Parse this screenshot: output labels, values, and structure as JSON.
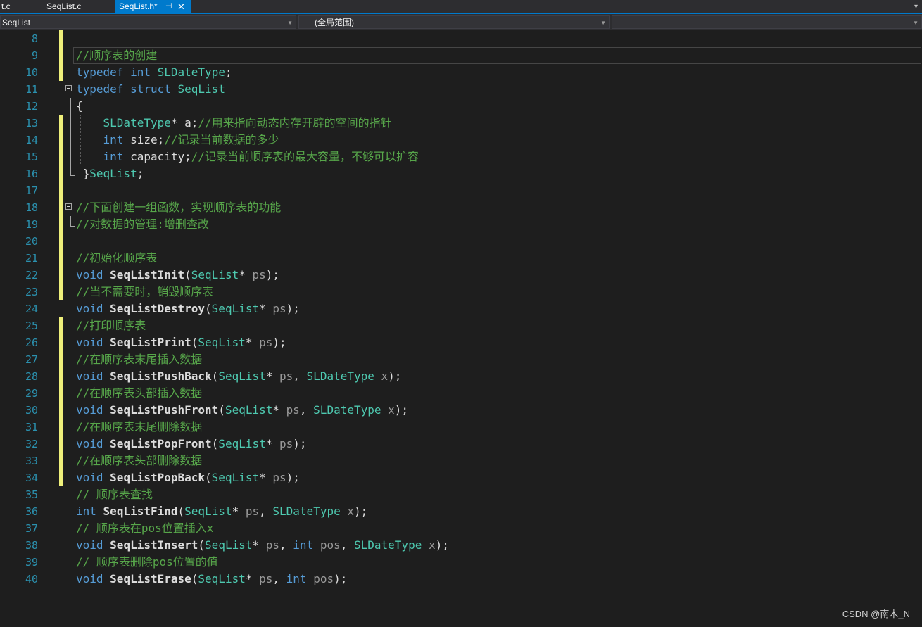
{
  "tabs": [
    {
      "label": "t.c"
    },
    {
      "label": "SeqList.c"
    },
    {
      "label": "SeqList.h*",
      "pin": "⊣",
      "close": "✕"
    }
  ],
  "nav": {
    "scope": "SeqList",
    "context": "(全局范围)",
    "member": ""
  },
  "watermark": "CSDN @南木_N",
  "colors": {
    "background": "#1e1e1e",
    "keyword": "#569cd6",
    "type": "#4ec9b0",
    "comment": "#57a64a",
    "line_number": "#2b91af",
    "change_marker": "#eff07b",
    "active_tab": "#007acc"
  },
  "lines": [
    {
      "n": "8",
      "chg": true,
      "seg": []
    },
    {
      "n": "9",
      "chg": true,
      "cur": true,
      "seg": [
        {
          "c": "cm",
          "t": "//顺序表的创建"
        }
      ]
    },
    {
      "n": "10",
      "chg": true,
      "seg": [
        {
          "c": "kw",
          "t": "typedef"
        },
        {
          "t": " "
        },
        {
          "c": "kw",
          "t": "int"
        },
        {
          "t": " "
        },
        {
          "c": "ty",
          "t": "SLDateType"
        },
        {
          "t": ";"
        }
      ]
    },
    {
      "n": "11",
      "fold": "open",
      "seg": [
        {
          "c": "kw",
          "t": "typedef"
        },
        {
          "t": " "
        },
        {
          "c": "kw",
          "t": "struct"
        },
        {
          "t": " "
        },
        {
          "c": "ty",
          "t": "SeqList"
        }
      ]
    },
    {
      "n": "12",
      "fold": "line",
      "seg": [
        {
          "t": "{"
        }
      ]
    },
    {
      "n": "13",
      "chg": true,
      "fold": "line",
      "guide": true,
      "seg": [
        {
          "t": "    "
        },
        {
          "c": "ty",
          "t": "SLDateType"
        },
        {
          "t": "* a;"
        },
        {
          "c": "cm",
          "t": "//用来指向动态内存开辟的空间的指针"
        }
      ]
    },
    {
      "n": "14",
      "chg": true,
      "fold": "line",
      "guide": true,
      "seg": [
        {
          "t": "    "
        },
        {
          "c": "kw",
          "t": "int"
        },
        {
          "t": " size;"
        },
        {
          "c": "cm",
          "t": "//记录当前数据的多少"
        }
      ]
    },
    {
      "n": "15",
      "chg": true,
      "fold": "line",
      "guide": true,
      "seg": [
        {
          "t": "    "
        },
        {
          "c": "kw",
          "t": "int"
        },
        {
          "t": " capacity;"
        },
        {
          "c": "cm",
          "t": "//记录当前顺序表的最大容量，不够可以扩容"
        }
      ]
    },
    {
      "n": "16",
      "chg": true,
      "fold": "end",
      "seg": [
        {
          "t": " }"
        },
        {
          "c": "ty",
          "t": "SeqList"
        },
        {
          "t": ";"
        }
      ]
    },
    {
      "n": "17",
      "chg": true,
      "seg": []
    },
    {
      "n": "18",
      "chg": true,
      "fold": "open",
      "seg": [
        {
          "c": "cm",
          "t": "//下面创建一组函数，实现顺序表的功能"
        }
      ]
    },
    {
      "n": "19",
      "chg": true,
      "fold": "end",
      "seg": [
        {
          "c": "cm",
          "t": "//对数据的管理:增删查改"
        }
      ]
    },
    {
      "n": "20",
      "chg": true,
      "seg": []
    },
    {
      "n": "21",
      "chg": true,
      "seg": [
        {
          "c": "cm",
          "t": "//初始化顺序表"
        }
      ]
    },
    {
      "n": "22",
      "chg": true,
      "seg": [
        {
          "c": "kw",
          "t": "void"
        },
        {
          "t": " "
        },
        {
          "c": "fn",
          "t": "SeqListInit"
        },
        {
          "t": "("
        },
        {
          "c": "ty",
          "t": "SeqList"
        },
        {
          "t": "* "
        },
        {
          "c": "pm",
          "t": "ps"
        },
        {
          "t": ");"
        }
      ]
    },
    {
      "n": "23",
      "chg": true,
      "seg": [
        {
          "c": "cm",
          "t": "//当不需要时，销毁顺序表"
        }
      ]
    },
    {
      "n": "24",
      "seg": [
        {
          "c": "kw",
          "t": "void"
        },
        {
          "t": " "
        },
        {
          "c": "fn",
          "t": "SeqListDestroy"
        },
        {
          "t": "("
        },
        {
          "c": "ty",
          "t": "SeqList"
        },
        {
          "t": "* "
        },
        {
          "c": "pm",
          "t": "ps"
        },
        {
          "t": ");"
        }
      ]
    },
    {
      "n": "25",
      "chg": true,
      "seg": [
        {
          "c": "cm",
          "t": "//打印顺序表"
        }
      ]
    },
    {
      "n": "26",
      "chg": true,
      "seg": [
        {
          "c": "kw",
          "t": "void"
        },
        {
          "t": " "
        },
        {
          "c": "fn",
          "t": "SeqListPrint"
        },
        {
          "t": "("
        },
        {
          "c": "ty",
          "t": "SeqList"
        },
        {
          "t": "* "
        },
        {
          "c": "pm",
          "t": "ps"
        },
        {
          "t": ");"
        }
      ]
    },
    {
      "n": "27",
      "chg": true,
      "seg": [
        {
          "c": "cm",
          "t": "//在顺序表末尾插入数据"
        }
      ]
    },
    {
      "n": "28",
      "chg": true,
      "seg": [
        {
          "c": "kw",
          "t": "void"
        },
        {
          "t": " "
        },
        {
          "c": "fn",
          "t": "SeqListPushBack"
        },
        {
          "t": "("
        },
        {
          "c": "ty",
          "t": "SeqList"
        },
        {
          "t": "* "
        },
        {
          "c": "pm",
          "t": "ps"
        },
        {
          "t": ", "
        },
        {
          "c": "ty",
          "t": "SLDateType"
        },
        {
          "t": " "
        },
        {
          "c": "pm",
          "t": "x"
        },
        {
          "t": ");"
        }
      ]
    },
    {
      "n": "29",
      "chg": true,
      "seg": [
        {
          "c": "cm",
          "t": "//在顺序表头部插入数据"
        }
      ]
    },
    {
      "n": "30",
      "chg": true,
      "seg": [
        {
          "c": "kw",
          "t": "void"
        },
        {
          "t": " "
        },
        {
          "c": "fn",
          "t": "SeqListPushFront"
        },
        {
          "t": "("
        },
        {
          "c": "ty",
          "t": "SeqList"
        },
        {
          "t": "* "
        },
        {
          "c": "pm",
          "t": "ps"
        },
        {
          "t": ", "
        },
        {
          "c": "ty",
          "t": "SLDateType"
        },
        {
          "t": " "
        },
        {
          "c": "pm",
          "t": "x"
        },
        {
          "t": ");"
        }
      ]
    },
    {
      "n": "31",
      "chg": true,
      "seg": [
        {
          "c": "cm",
          "t": "//在顺序表末尾删除数据"
        }
      ]
    },
    {
      "n": "32",
      "chg": true,
      "seg": [
        {
          "c": "kw",
          "t": "void"
        },
        {
          "t": " "
        },
        {
          "c": "fn",
          "t": "SeqListPopFront"
        },
        {
          "t": "("
        },
        {
          "c": "ty",
          "t": "SeqList"
        },
        {
          "t": "* "
        },
        {
          "c": "pm",
          "t": "ps"
        },
        {
          "t": ");"
        }
      ]
    },
    {
      "n": "33",
      "chg": true,
      "seg": [
        {
          "c": "cm",
          "t": "//在顺序表头部删除数据"
        }
      ]
    },
    {
      "n": "34",
      "chg": true,
      "seg": [
        {
          "c": "kw",
          "t": "void"
        },
        {
          "t": " "
        },
        {
          "c": "fn",
          "t": "SeqListPopBack"
        },
        {
          "t": "("
        },
        {
          "c": "ty",
          "t": "SeqList"
        },
        {
          "t": "* "
        },
        {
          "c": "pm",
          "t": "ps"
        },
        {
          "t": ");"
        }
      ]
    },
    {
      "n": "35",
      "seg": [
        {
          "c": "cm",
          "t": "// 顺序表查找"
        }
      ]
    },
    {
      "n": "36",
      "seg": [
        {
          "c": "kw",
          "t": "int"
        },
        {
          "t": " "
        },
        {
          "c": "fn",
          "t": "SeqListFind"
        },
        {
          "t": "("
        },
        {
          "c": "ty",
          "t": "SeqList"
        },
        {
          "t": "* "
        },
        {
          "c": "pm",
          "t": "ps"
        },
        {
          "t": ", "
        },
        {
          "c": "ty",
          "t": "SLDateType"
        },
        {
          "t": " "
        },
        {
          "c": "pm",
          "t": "x"
        },
        {
          "t": ");"
        }
      ]
    },
    {
      "n": "37",
      "seg": [
        {
          "c": "cm",
          "t": "// 顺序表在pos位置插入x"
        }
      ]
    },
    {
      "n": "38",
      "seg": [
        {
          "c": "kw",
          "t": "void"
        },
        {
          "t": " "
        },
        {
          "c": "fn",
          "t": "SeqListInsert"
        },
        {
          "t": "("
        },
        {
          "c": "ty",
          "t": "SeqList"
        },
        {
          "t": "* "
        },
        {
          "c": "pm",
          "t": "ps"
        },
        {
          "t": ", "
        },
        {
          "c": "kw",
          "t": "int"
        },
        {
          "t": " "
        },
        {
          "c": "pm",
          "t": "pos"
        },
        {
          "t": ", "
        },
        {
          "c": "ty",
          "t": "SLDateType"
        },
        {
          "t": " "
        },
        {
          "c": "pm",
          "t": "x"
        },
        {
          "t": ");"
        }
      ]
    },
    {
      "n": "39",
      "seg": [
        {
          "c": "cm",
          "t": "// 顺序表删除pos位置的值"
        }
      ]
    },
    {
      "n": "40",
      "seg": [
        {
          "c": "kw",
          "t": "void"
        },
        {
          "t": " "
        },
        {
          "c": "fn",
          "t": "SeqListErase"
        },
        {
          "t": "("
        },
        {
          "c": "ty",
          "t": "SeqList"
        },
        {
          "t": "* "
        },
        {
          "c": "pm",
          "t": "ps"
        },
        {
          "t": ", "
        },
        {
          "c": "kw",
          "t": "int"
        },
        {
          "t": " "
        },
        {
          "c": "pm",
          "t": "pos"
        },
        {
          "t": ");"
        }
      ]
    }
  ]
}
